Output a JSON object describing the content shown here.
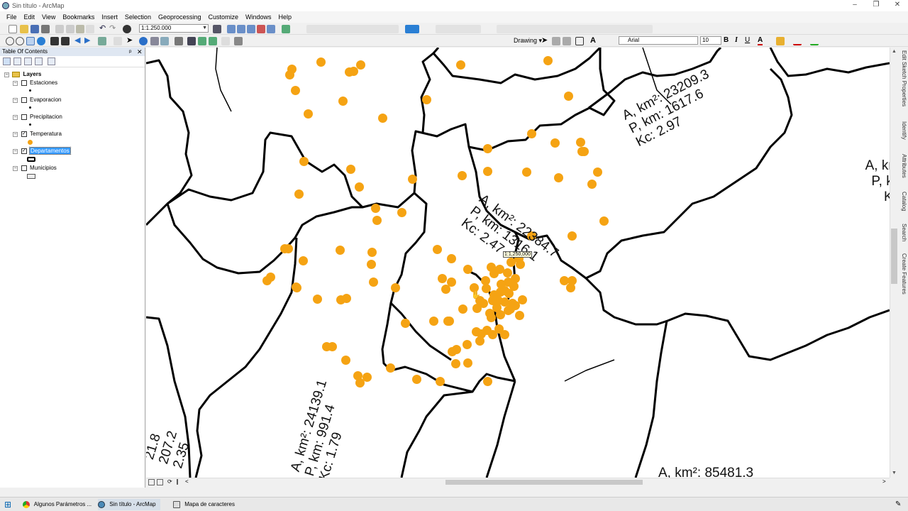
{
  "window": {
    "title": "Sin título - ArcMap",
    "min": "–",
    "max": "❐",
    "close": "✕"
  },
  "menu": [
    "File",
    "Edit",
    "View",
    "Bookmarks",
    "Insert",
    "Selection",
    "Geoprocessing",
    "Customize",
    "Windows",
    "Help"
  ],
  "toolbar": {
    "scale": "1:1.250.000",
    "drawing_label": "Drawing ▾",
    "font": "Arial",
    "font_size": "10",
    "bold": "B",
    "italic": "I",
    "underline": "U",
    "text_a": "A"
  },
  "toc": {
    "title": "Table Of Contents",
    "pin": "ᵖ",
    "close": "✕",
    "root": "Layers",
    "layers": [
      {
        "name": "Estaciones",
        "checked": false,
        "symbol": "dot-black"
      },
      {
        "name": "Evaporacion",
        "checked": false,
        "symbol": "dot-black"
      },
      {
        "name": "Precipitacion",
        "checked": false,
        "symbol": "dot-black"
      },
      {
        "name": "Temperatura",
        "checked": true,
        "symbol": "dot-orange"
      },
      {
        "name": "Departamentos",
        "checked": true,
        "symbol": "poly-black",
        "selected": true
      },
      {
        "name": "Municipios",
        "checked": false,
        "symbol": "poly-gray"
      }
    ]
  },
  "map": {
    "labels": [
      {
        "lines": [
          "A, km²: 23209.3",
          "P, km: 1617.6",
          "Kc: 2.97"
        ]
      },
      {
        "lines": [
          "A, km²: 22384.7",
          "P, km: 1316.1",
          "Kc: 2.47"
        ]
      },
      {
        "lines": [
          "A, km²: 24139.1",
          "P, km: 991.4",
          "Kc: 1.79"
        ]
      },
      {
        "lines": [
          "A, kr",
          "P, k",
          "K"
        ]
      },
      {
        "lines": [
          "21.8",
          "207.2",
          "2.35"
        ]
      },
      {
        "lines": [
          "A, km²: 85481.3"
        ]
      }
    ],
    "scale_tip": "1:1,250,000",
    "point_color": "#f5a313",
    "boundary_color": "#000000"
  },
  "side_tabs": [
    "Edit Sketch Properties",
    "Identify",
    "Attributes",
    "Catalog",
    "Search",
    "Create Features"
  ],
  "taskbar": [
    {
      "label": "Algunos Parámetros ...",
      "icon": "chrome-icon"
    },
    {
      "label": "Sin título - ArcMap",
      "icon": "arcmap-icon"
    },
    {
      "label": "Mapa de caracteres",
      "icon": "charmap-icon"
    }
  ]
}
